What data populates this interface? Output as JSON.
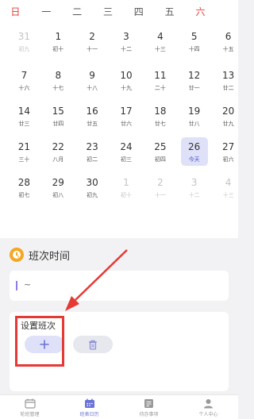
{
  "weekdays": [
    "日",
    "一",
    "二",
    "三",
    "四",
    "五",
    "六"
  ],
  "days": [
    {
      "n": "31",
      "l": "初九",
      "dim": true
    },
    {
      "n": "1",
      "l": "初十"
    },
    {
      "n": "2",
      "l": "十一"
    },
    {
      "n": "3",
      "l": "十二"
    },
    {
      "n": "4",
      "l": "十三"
    },
    {
      "n": "5",
      "l": "十四"
    },
    {
      "n": "6",
      "l": "十五"
    },
    {
      "n": "7",
      "l": "十六"
    },
    {
      "n": "8",
      "l": "十七"
    },
    {
      "n": "9",
      "l": "十八"
    },
    {
      "n": "10",
      "l": "十九"
    },
    {
      "n": "11",
      "l": "二十"
    },
    {
      "n": "12",
      "l": "廿一"
    },
    {
      "n": "13",
      "l": "廿二"
    },
    {
      "n": "14",
      "l": "廿三"
    },
    {
      "n": "15",
      "l": "廿四"
    },
    {
      "n": "16",
      "l": "廿五"
    },
    {
      "n": "17",
      "l": "廿六"
    },
    {
      "n": "18",
      "l": "廿七"
    },
    {
      "n": "19",
      "l": "廿八"
    },
    {
      "n": "20",
      "l": "廿九"
    },
    {
      "n": "21",
      "l": "三十"
    },
    {
      "n": "22",
      "l": "八月"
    },
    {
      "n": "23",
      "l": "初二"
    },
    {
      "n": "24",
      "l": "初三"
    },
    {
      "n": "25",
      "l": "初四"
    },
    {
      "n": "26",
      "l": "今天",
      "today": true
    },
    {
      "n": "27",
      "l": "初六"
    },
    {
      "n": "28",
      "l": "初七"
    },
    {
      "n": "29",
      "l": "初八"
    },
    {
      "n": "30",
      "l": "初九"
    },
    {
      "n": "1",
      "l": "初十",
      "dim": true
    },
    {
      "n": "2",
      "l": "十一",
      "dim": true
    },
    {
      "n": "3",
      "l": "十二",
      "dim": true
    },
    {
      "n": "4",
      "l": "十三",
      "dim": true
    }
  ],
  "shift_time": {
    "title": "班次时间",
    "value": "~"
  },
  "set_shift": {
    "title": "设置班次",
    "add_icon": "plus-icon",
    "delete_icon": "trash-icon"
  },
  "tabs": [
    {
      "label": "轮班管理",
      "icon": "shift-icon"
    },
    {
      "label": "班表日历",
      "icon": "calendar-icon",
      "active": true
    },
    {
      "label": "待办事项",
      "icon": "todo-icon"
    },
    {
      "label": "个人中心",
      "icon": "person-icon"
    }
  ],
  "colors": {
    "accent": "#6b74d6",
    "highlight": "#e53935",
    "today_bg": "#dfe1f8",
    "clock": "#f5a623"
  }
}
